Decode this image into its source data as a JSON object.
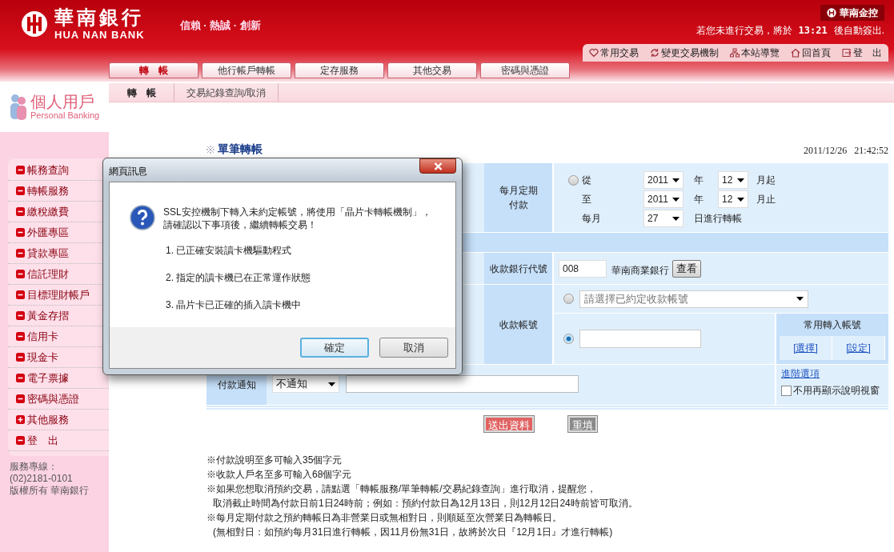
{
  "header": {
    "bank_name": "華南銀行",
    "bank_name_en": "HUA NAN BANK",
    "slogan": "信賴 · 熱誠 · 創新",
    "group_name": "華南金控",
    "logout_notice": {
      "prefix": "若您未進行交易，將於",
      "time": "13:21",
      "suffix": "後自動簽出."
    }
  },
  "top_links": [
    {
      "label": "常用交易",
      "kind": "heart"
    },
    {
      "label": "變更交易機制",
      "kind": "refresh"
    },
    {
      "label": "本站導覽",
      "kind": "sitemap"
    },
    {
      "label": "回首頁",
      "kind": "home"
    },
    {
      "label": "登　出",
      "kind": "logout"
    }
  ],
  "tabs": [
    {
      "label": "轉　帳",
      "selected": true
    },
    {
      "label": "他行帳戶轉帳",
      "selected": false
    },
    {
      "label": "定存服務",
      "selected": false
    },
    {
      "label": "其他交易",
      "selected": false
    },
    {
      "label": "密碼與憑證",
      "selected": false
    }
  ],
  "subtabs": [
    {
      "label": "轉　帳",
      "selected": true
    },
    {
      "label": "交易紀錄查詢/取消",
      "selected": false
    }
  ],
  "personal": {
    "title": "個人用戶",
    "subtitle": "Personal Banking"
  },
  "sidebar": {
    "items": [
      {
        "label": "帳務查詢",
        "expanded": true
      },
      {
        "label": "轉帳服務",
        "expanded": true
      },
      {
        "label": "繳稅繳費",
        "expanded": true
      },
      {
        "label": "外匯專區",
        "expanded": true
      },
      {
        "label": "貸款專區",
        "expanded": true
      },
      {
        "label": "信託理財",
        "expanded": true
      },
      {
        "label": "目標理財帳戶",
        "expanded": true
      },
      {
        "label": "黃金存摺",
        "expanded": true
      },
      {
        "label": "信用卡",
        "expanded": true
      },
      {
        "label": "現金卡",
        "expanded": true
      },
      {
        "label": "電子票據",
        "expanded": true
      },
      {
        "label": "密碼與憑證",
        "expanded": true
      },
      {
        "label": "其他服務",
        "expanded": false
      },
      {
        "label": "登　出",
        "expanded": true
      }
    ],
    "footer": [
      "服務專線：",
      "(02)2181-0101",
      "版權所有 華南銀行"
    ]
  },
  "page_title": "單筆轉帳",
  "datetime": "2011/12/26   21:42:52",
  "form": {
    "monthly": {
      "label": "每月定期付款",
      "radio_selected": false,
      "from_label": "從",
      "from_year": "2011",
      "from_year_unit": "年",
      "from_month": "12",
      "from_suffix": "月起",
      "to_label": "至",
      "to_year": "2011",
      "to_year_unit": "年",
      "to_month": "12",
      "to_suffix": "月止",
      "day_label": "每月",
      "day": "27",
      "day_suffix": "日進行轉帳"
    },
    "bank_code": {
      "label": "收款銀行代號",
      "value": "008",
      "bank_name": "華南商業銀行",
      "button": "查看"
    },
    "account": {
      "label": "收款帳號",
      "options": [
        {
          "kind": "select",
          "selected": false,
          "value": "請選擇已約定收款帳號"
        },
        {
          "kind": "input",
          "selected": true
        }
      ],
      "favorites": {
        "title": "常用轉入帳號",
        "links": [
          "[選擇]",
          "[設定]"
        ]
      }
    },
    "notify": {
      "label": "付款通知",
      "value": "不通知"
    },
    "advanced": {
      "link": "進階選項",
      "checkbox": {
        "label": "不用再顯示說明視窗",
        "checked": false
      }
    }
  },
  "buttons": [
    {
      "label": "送出資料",
      "kind": "submit"
    },
    {
      "label": "重填",
      "kind": "reset"
    }
  ],
  "notes": [
    "※付款說明至多可輸入35個字元",
    "※收款人戶名至多可輸入68個字元",
    "※如果您想取消預約交易，請點選「轉帳服務/單筆轉帳/交易紀錄查詢」進行取消，提醒您，",
    "取消截止時間為付款日前1日24時前；例如：預約付款日為12月13日，則12月12日24時前皆可取消。",
    "※每月定期付款之預約轉帳日為非營業日或無相對日，則順延至次營業日為轉帳日。",
    "(無相對日：如預約每月31日進行轉帳，因11月份無31日，故將於次日『12月1日』才進行轉帳)"
  ],
  "dialog": {
    "title": "網頁訊息",
    "message_lines": [
      "SSL安控機制下轉入未約定帳號，將使用「晶片卡轉帳機制」，",
      "請確認以下事項後，繼續轉帳交易！"
    ],
    "items": [
      "1. 已正確安裝讀卡機驅動程式",
      "2. 指定的讀卡機已在正常運作狀態",
      "3. 晶片卡已正確的插入讀卡機中"
    ],
    "buttons": [
      {
        "label": "確定",
        "default": true
      },
      {
        "label": "取消",
        "default": false
      }
    ]
  }
}
